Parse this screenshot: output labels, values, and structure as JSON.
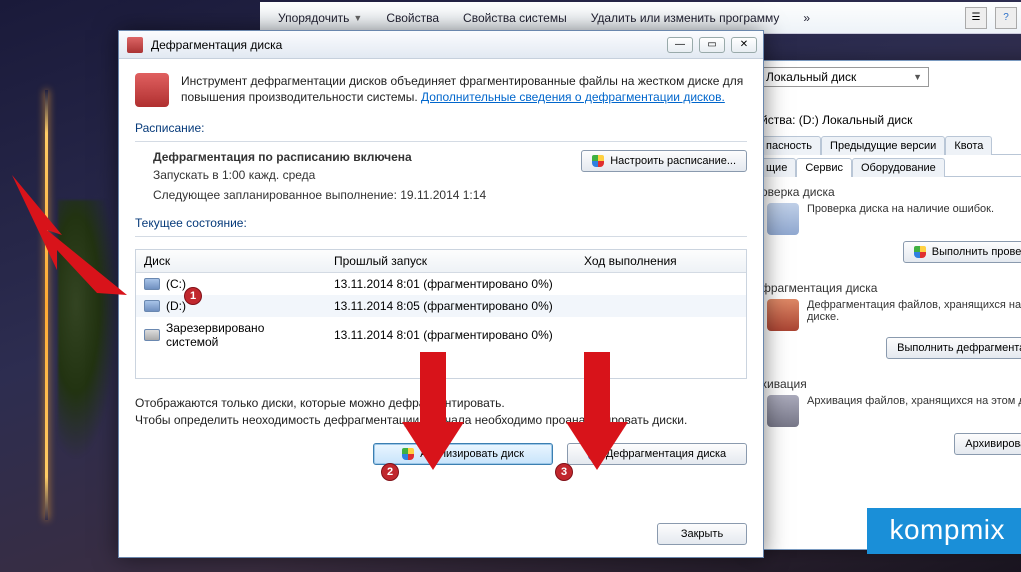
{
  "toolbar": {
    "organize": "Упорядочить",
    "properties": "Свойства",
    "system_properties": "Свойства системы",
    "uninstall": "Удалить или изменить программу"
  },
  "props": {
    "combo_label": "Локальный диск",
    "title": "йства: (D:) Локальный диск",
    "tabs": {
      "security": "пасность",
      "prev": "Предыдущие версии",
      "quota": "Квота",
      "general": "щие",
      "service": "Сервис",
      "hardware": "Оборудование"
    },
    "check": {
      "title": "оверка диска",
      "text": "Проверка диска на наличие ошибок.",
      "button": "Выполнить проверку..."
    },
    "defrag": {
      "title": "фрагментация диска",
      "text": "Дефрагментация файлов, хранящихся на это диске.",
      "button": "Выполнить дефрагментацию"
    },
    "backup": {
      "title": "хивация",
      "text": "Архивация файлов, хранящихся на этом диск",
      "button": "Архивировать..."
    }
  },
  "dlg": {
    "title": "Дефрагментация диска",
    "intro_text": "Инструмент дефрагментации дисков объединяет фрагментированные файлы на жестком диске для повышения производительности системы. ",
    "intro_link": "Дополнительные сведения о дефрагментации дисков.",
    "schedule_label": "Расписание:",
    "schedule_on": "Дефрагментация по расписанию включена",
    "schedule_time": "Запускать в 1:00 кажд. среда",
    "schedule_next": "Следующее запланированное выполнение: 19.11.2014 1:14",
    "configure_btn": "Настроить расписание...",
    "current_label": "Текущее состояние:",
    "columns": {
      "disk": "Диск",
      "last": "Прошлый запуск",
      "progress": "Ход выполнения"
    },
    "rows": [
      {
        "name": "(C:)",
        "last": "13.11.2014 8:01 (фрагментировано 0%)"
      },
      {
        "name": "(D:)",
        "last": "13.11.2014 8:05 (фрагментировано 0%)"
      },
      {
        "name": "Зарезервировано системой",
        "last": "13.11.2014 8:01 (фрагментировано 0%)"
      }
    ],
    "hint1": "Отображаются только диски, которые можно дефрагментировать.",
    "hint2": "Чтобы определить неоходимость дефрагментации, сначала необходимо проанализировать диски.",
    "analyze_btn": "Анализировать диск",
    "defrag_btn": "Дефрагментация диска",
    "close_btn": "Закрыть"
  },
  "watermark": "kompmix"
}
